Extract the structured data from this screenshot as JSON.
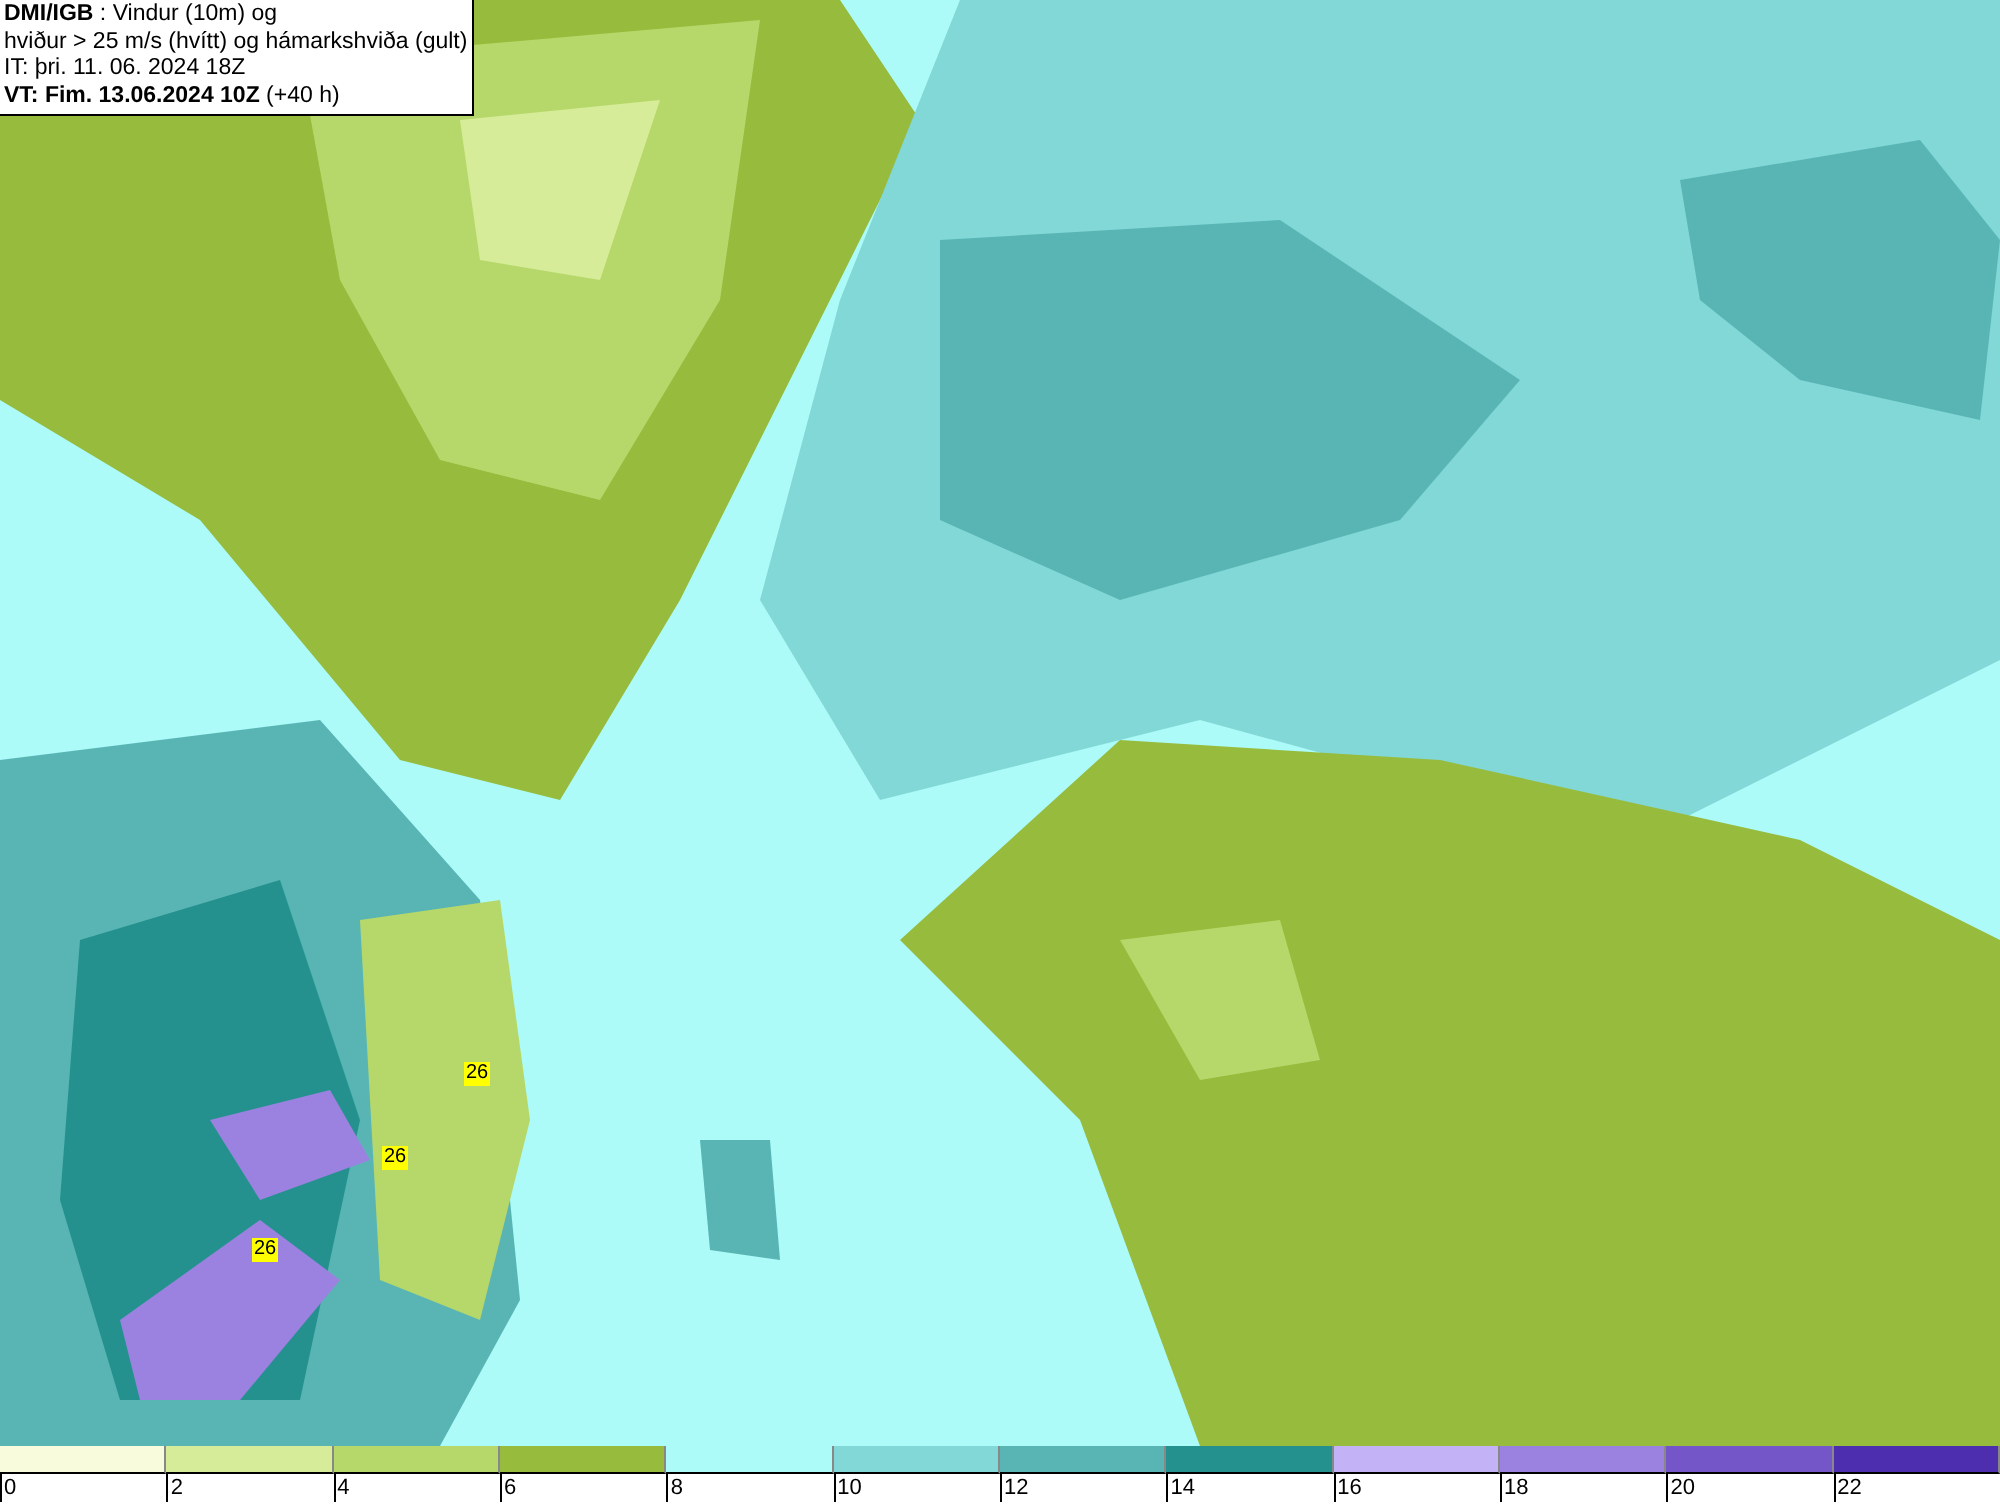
{
  "info_box": {
    "lines": [
      "**DMI/IGB** : Vindur (10m) og",
      "hviður > 25 m/s (hvítt) og hámarkshviða (gult)",
      "IT: þri. 11. 06. 2024 18Z",
      "**VT: Fim. 13.06.2024 10Z** (+40 h)"
    ]
  },
  "map": {
    "gust_labels": [
      {
        "text": "26"
      },
      {
        "text": "26"
      },
      {
        "text": "26"
      }
    ]
  },
  "legend": {
    "segments": [
      {
        "label": "0",
        "color": "#f8fcdc"
      },
      {
        "label": "2",
        "color": "#d6ec98"
      },
      {
        "label": "4",
        "color": "#b6d86a"
      },
      {
        "label": "6",
        "color": "#97bb3c"
      },
      {
        "label": "8",
        "color": "#acfbf8"
      },
      {
        "label": "10",
        "color": "#82d8d6"
      },
      {
        "label": "12",
        "color": "#58b5b4"
      },
      {
        "label": "14",
        "color": "#24918e"
      },
      {
        "label": "16",
        "color": "#c4b2f6"
      },
      {
        "label": "18",
        "color": "#9c82e0"
      },
      {
        "label": "20",
        "color": "#7456c8"
      },
      {
        "label": "22",
        "color": "#4c2eae"
      }
    ]
  }
}
